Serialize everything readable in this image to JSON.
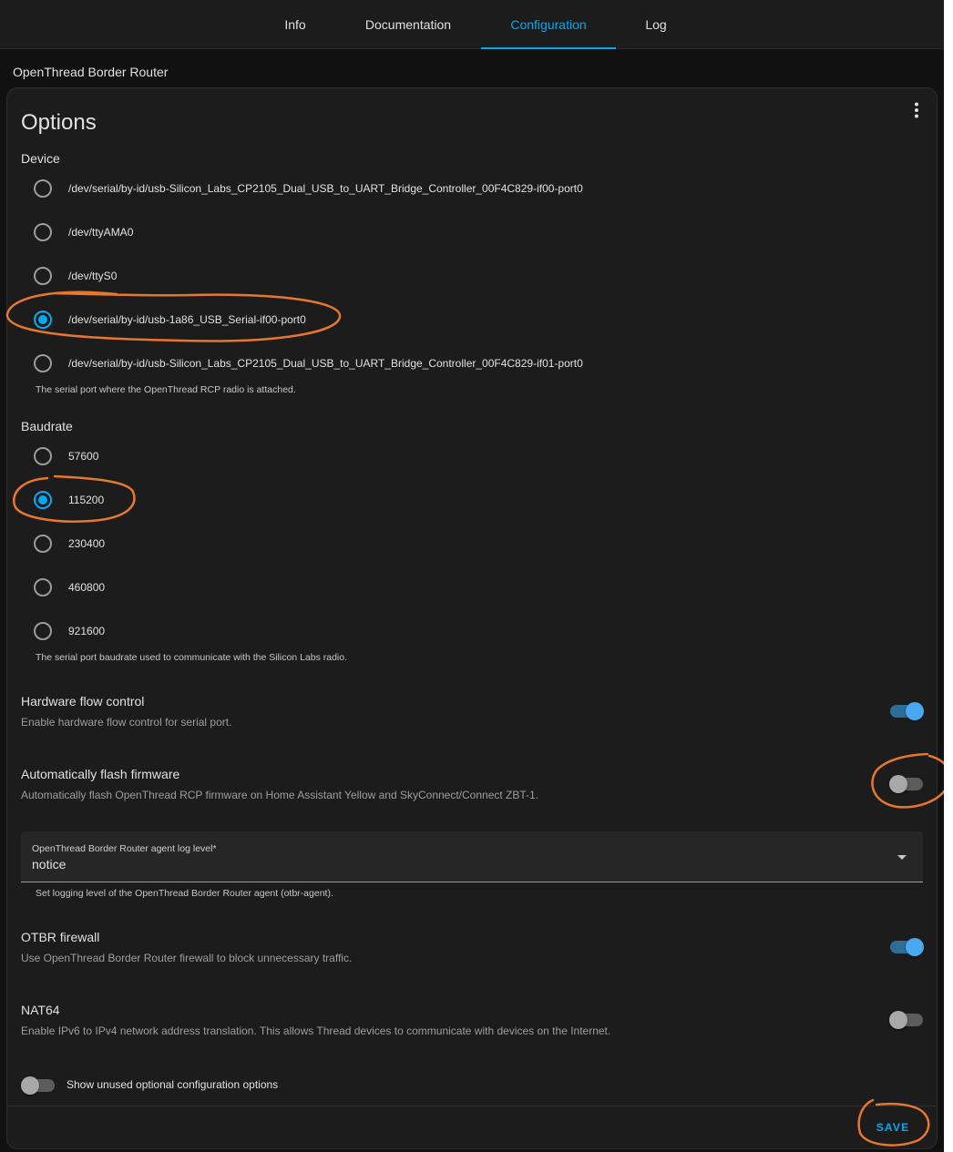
{
  "tabs": [
    {
      "label": "Info"
    },
    {
      "label": "Documentation"
    },
    {
      "label": "Configuration",
      "active": true
    },
    {
      "label": "Log"
    }
  ],
  "addon_title": "OpenThread Border Router",
  "card": {
    "title": "Options",
    "menu_icon": "dots-vertical-icon"
  },
  "device": {
    "label": "Device",
    "options": [
      {
        "label": "/dev/serial/by-id/usb-Silicon_Labs_CP2105_Dual_USB_to_UART_Bridge_Controller_00F4C829-if00-port0",
        "selected": false
      },
      {
        "label": "/dev/ttyAMA0",
        "selected": false
      },
      {
        "label": "/dev/ttyS0",
        "selected": false
      },
      {
        "label": "/dev/serial/by-id/usb-1a86_USB_Serial-if00-port0",
        "selected": true
      },
      {
        "label": "/dev/serial/by-id/usb-Silicon_Labs_CP2105_Dual_USB_to_UART_Bridge_Controller_00F4C829-if01-port0",
        "selected": false
      }
    ],
    "helper": "The serial port where the OpenThread RCP radio is attached."
  },
  "baudrate": {
    "label": "Baudrate",
    "options": [
      {
        "label": "57600",
        "selected": false
      },
      {
        "label": "115200",
        "selected": true
      },
      {
        "label": "230400",
        "selected": false
      },
      {
        "label": "460800",
        "selected": false
      },
      {
        "label": "921600",
        "selected": false
      }
    ],
    "helper": "The serial port baudrate used to communicate with the Silicon Labs radio."
  },
  "hardware_flow_control": {
    "title": "Hardware flow control",
    "description": "Enable hardware flow control for serial port.",
    "enabled": true
  },
  "auto_flash": {
    "title": "Automatically flash firmware",
    "description": "Automatically flash OpenThread RCP firmware on Home Assistant Yellow and SkyConnect/Connect ZBT-1.",
    "enabled": false
  },
  "log_level": {
    "label": "OpenThread Border Router agent log level*",
    "value": "notice",
    "helper": "Set logging level of the OpenThread Border Router agent (otbr-agent)."
  },
  "otbr_firewall": {
    "title": "OTBR firewall",
    "description": "Use OpenThread Border Router firewall to block unnecessary traffic.",
    "enabled": true
  },
  "nat64": {
    "title": "NAT64",
    "description": "Enable IPv6 to IPv4 network address translation. This allows Thread devices to communicate with devices on the Internet.",
    "enabled": false
  },
  "show_unused": {
    "label": "Show unused optional configuration options",
    "enabled": false
  },
  "save_label": "SAVE",
  "colors": {
    "accent": "#03a9f4",
    "background": "#111111",
    "card": "#1c1c1c",
    "annotation": "#e8772e"
  }
}
